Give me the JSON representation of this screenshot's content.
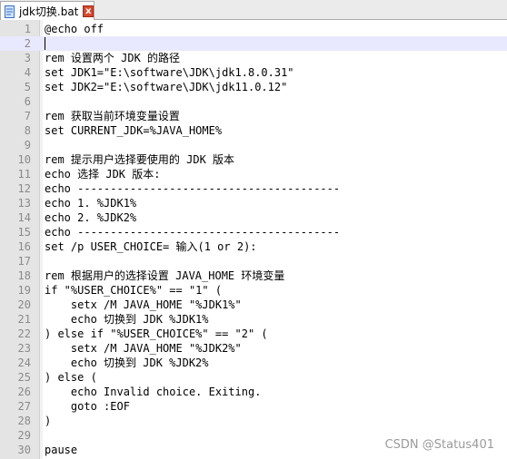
{
  "tab": {
    "filename": "jdk切换.bat",
    "close_label": "x"
  },
  "editor": {
    "current_line": 2,
    "lines": [
      {
        "n": "1",
        "text": "@echo off"
      },
      {
        "n": "2",
        "text": ""
      },
      {
        "n": "3",
        "text": "rem 设置两个 JDK 的路径"
      },
      {
        "n": "4",
        "text": "set JDK1=\"E:\\software\\JDK\\jdk1.8.0.31\""
      },
      {
        "n": "5",
        "text": "set JDK2=\"E:\\software\\JDK\\jdk11.0.12\""
      },
      {
        "n": "6",
        "text": ""
      },
      {
        "n": "7",
        "text": "rem 获取当前环境变量设置"
      },
      {
        "n": "8",
        "text": "set CURRENT_JDK=%JAVA_HOME%"
      },
      {
        "n": "9",
        "text": ""
      },
      {
        "n": "10",
        "text": "rem 提示用户选择要使用的 JDK 版本"
      },
      {
        "n": "11",
        "text": "echo 选择 JDK 版本:"
      },
      {
        "n": "12",
        "text": "echo ----------------------------------------"
      },
      {
        "n": "13",
        "text": "echo 1. %JDK1%"
      },
      {
        "n": "14",
        "text": "echo 2. %JDK2%"
      },
      {
        "n": "15",
        "text": "echo ----------------------------------------"
      },
      {
        "n": "16",
        "text": "set /p USER_CHOICE= 输入(1 or 2):"
      },
      {
        "n": "17",
        "text": ""
      },
      {
        "n": "18",
        "text": "rem 根据用户的选择设置 JAVA_HOME 环境变量"
      },
      {
        "n": "19",
        "text": "if \"%USER_CHOICE%\" == \"1\" ("
      },
      {
        "n": "20",
        "text": "    setx /M JAVA_HOME \"%JDK1%\""
      },
      {
        "n": "21",
        "text": "    echo 切换到 JDK %JDK1%"
      },
      {
        "n": "22",
        "text": ") else if \"%USER_CHOICE%\" == \"2\" ("
      },
      {
        "n": "23",
        "text": "    setx /M JAVA_HOME \"%JDK2%\""
      },
      {
        "n": "24",
        "text": "    echo 切换到 JDK %JDK2%"
      },
      {
        "n": "25",
        "text": ") else ("
      },
      {
        "n": "26",
        "text": "    echo Invalid choice. Exiting."
      },
      {
        "n": "27",
        "text": "    goto :EOF"
      },
      {
        "n": "28",
        "text": ")"
      },
      {
        "n": "29",
        "text": ""
      },
      {
        "n": "30",
        "text": "pause"
      }
    ]
  },
  "watermark": "CSDN @Status401"
}
